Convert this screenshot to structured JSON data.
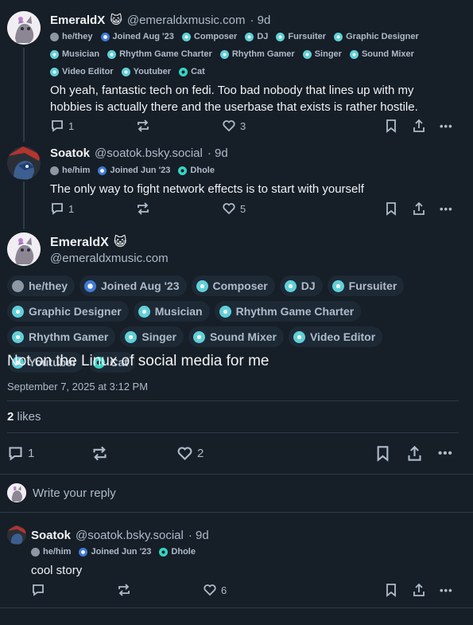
{
  "post1": {
    "display_name": "EmeraldX",
    "name_emoji": "😺",
    "handle": "@emeraldxmusic.com",
    "age": "· 9d",
    "badges": [
      {
        "label": "he/they",
        "kind": "pronoun"
      },
      {
        "label": "Joined Aug '23",
        "kind": "join"
      },
      {
        "label": "Composer",
        "kind": "role"
      },
      {
        "label": "DJ",
        "kind": "role"
      },
      {
        "label": "Fursuiter",
        "kind": "role"
      },
      {
        "label": "Graphic Designer",
        "kind": "role"
      },
      {
        "label": "Musician",
        "kind": "role"
      },
      {
        "label": "Rhythm Game Charter",
        "kind": "role"
      },
      {
        "label": "Rhythm Gamer",
        "kind": "role"
      },
      {
        "label": "Singer",
        "kind": "role"
      },
      {
        "label": "Sound Mixer",
        "kind": "role"
      },
      {
        "label": "Video Editor",
        "kind": "role"
      },
      {
        "label": "Youtuber",
        "kind": "role"
      },
      {
        "label": "Cat",
        "kind": "dhole"
      }
    ],
    "text": "Oh yeah, fantastic tech on fedi. Too bad nobody that lines up with my hobbies is actually there and the userbase that exists is rather hostile.",
    "replies": "1",
    "likes": "3"
  },
  "post2": {
    "display_name": "Soatok",
    "handle": "@soatok.bsky.social",
    "age": "· 9d",
    "badges": [
      {
        "label": "he/him",
        "kind": "pronoun"
      },
      {
        "label": "Joined Jun '23",
        "kind": "join"
      },
      {
        "label": "Dhole",
        "kind": "dhole"
      }
    ],
    "text": "The only way to fight network effects is to start with yourself",
    "replies": "1",
    "likes": "5"
  },
  "main_post": {
    "display_name": "EmeraldX",
    "name_emoji": "😺",
    "handle": "@emeraldxmusic.com",
    "badges": [
      {
        "label": "he/they",
        "kind": "pronoun"
      },
      {
        "label": "Joined Aug '23",
        "kind": "join"
      },
      {
        "label": "Composer",
        "kind": "role"
      },
      {
        "label": "DJ",
        "kind": "role"
      },
      {
        "label": "Fursuiter",
        "kind": "role"
      },
      {
        "label": "Graphic Designer",
        "kind": "role"
      },
      {
        "label": "Musician",
        "kind": "role"
      },
      {
        "label": "Rhythm Game Charter",
        "kind": "role"
      },
      {
        "label": "Rhythm Gamer",
        "kind": "role"
      },
      {
        "label": "Singer",
        "kind": "role"
      },
      {
        "label": "Sound Mixer",
        "kind": "role"
      },
      {
        "label": "Video Editor",
        "kind": "role"
      },
      {
        "label": "Youtuber",
        "kind": "role"
      },
      {
        "label": "Cat",
        "kind": "dhole"
      }
    ],
    "text": "Not on the Linux of social media for me",
    "timestamp": "September 7, 2025 at 3:12 PM",
    "likes_count": "2",
    "likes_label": "likes",
    "replies": "1",
    "likes": "2"
  },
  "reply_box": {
    "placeholder": "Write your reply"
  },
  "reply1": {
    "display_name": "Soatok",
    "handle": "@soatok.bsky.social",
    "age": "· 9d",
    "badges": [
      {
        "label": "he/him",
        "kind": "pronoun"
      },
      {
        "label": "Joined Jun '23",
        "kind": "join"
      },
      {
        "label": "Dhole",
        "kind": "dhole"
      }
    ],
    "text": "cool story",
    "likes": "6"
  },
  "colors": {
    "background": "#161e27",
    "text": "#f1f3f5",
    "muted": "#aebbc9",
    "role_badge": "#5fd0d8",
    "join_badge": "#3f7bd6",
    "dhole_badge": "#34d6c5"
  }
}
